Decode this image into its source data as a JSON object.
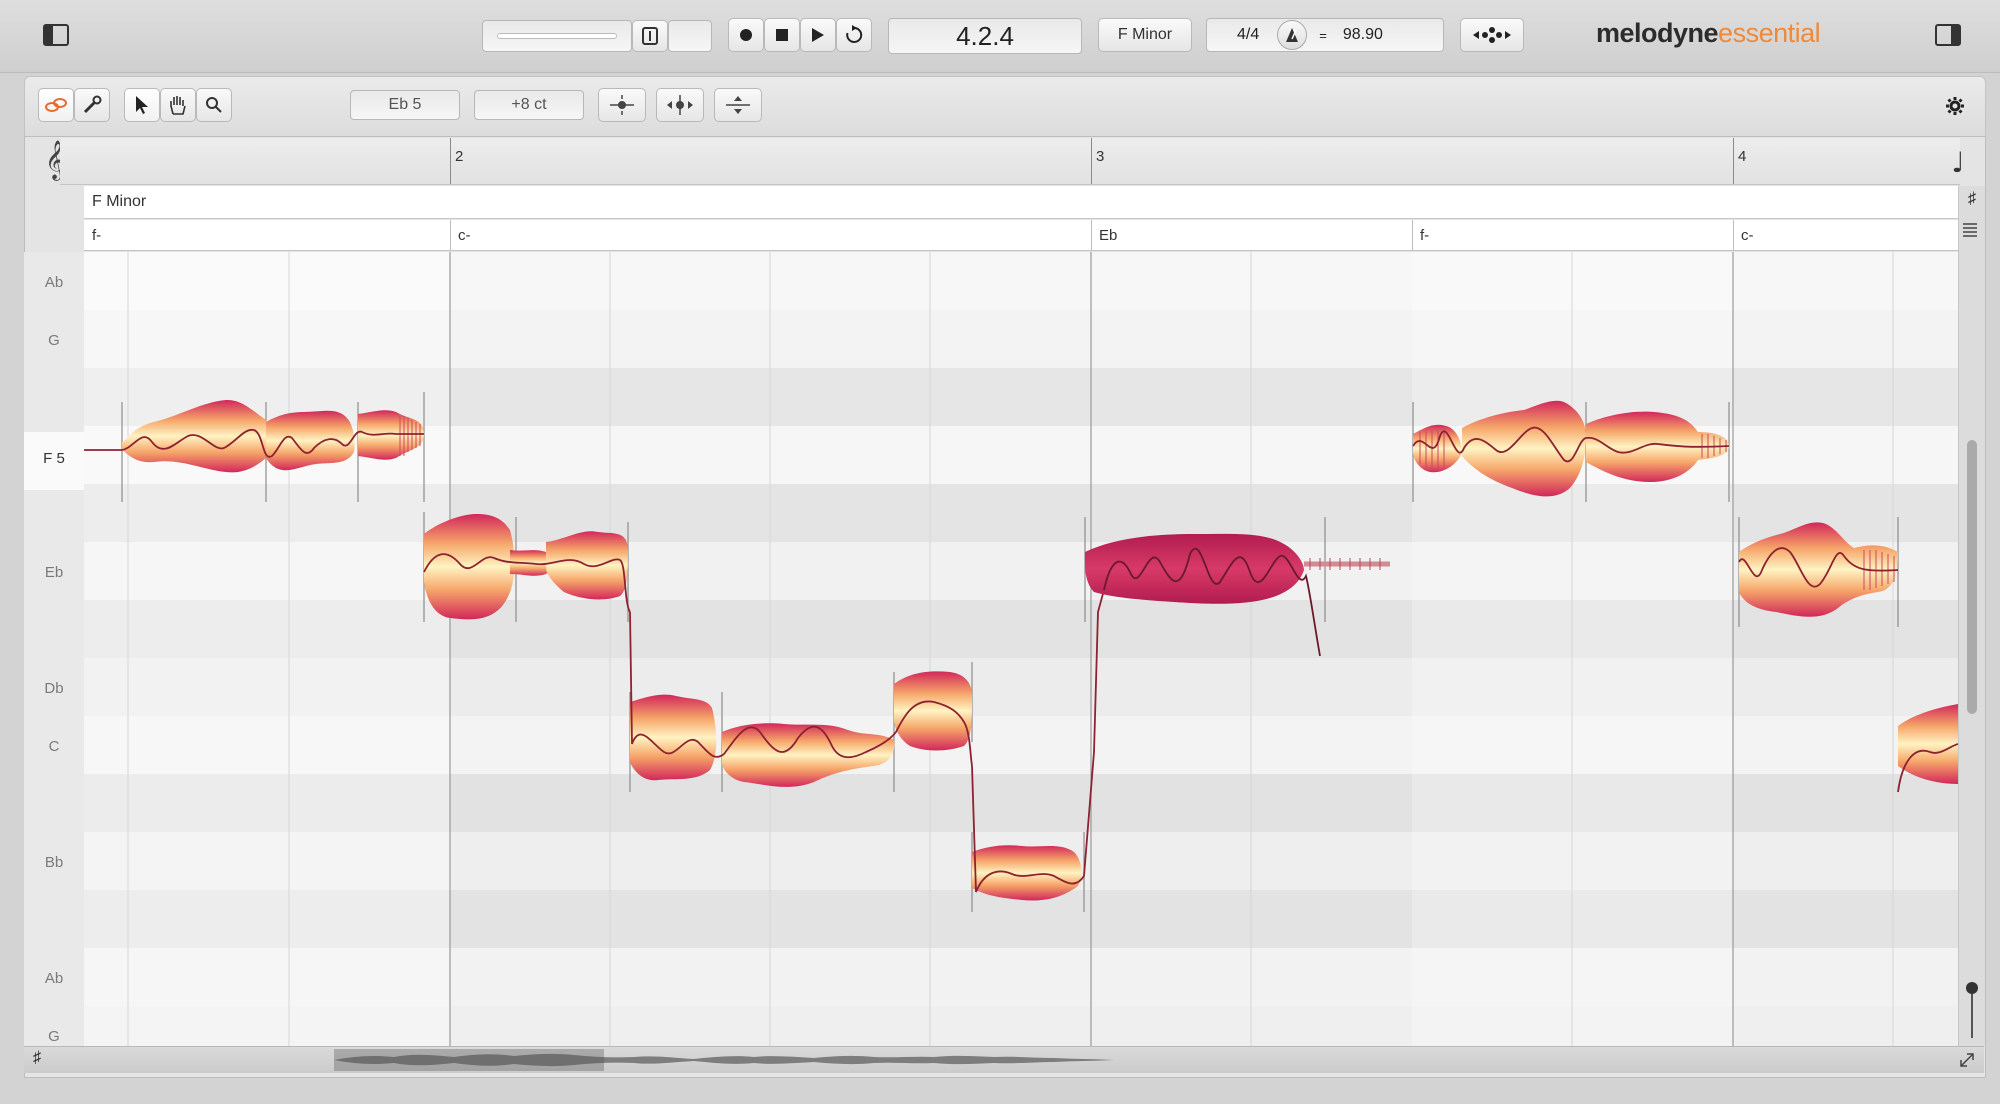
{
  "transport": {
    "position": "4.2.4",
    "key": "F Minor",
    "time_signature": "4/4",
    "tempo_eq": "=",
    "tempo": "98.90"
  },
  "brand": {
    "name": "melodyne",
    "edition": "essential"
  },
  "toolbar": {
    "pitch_readout": "Eb 5",
    "cents_readout": "+8 ct"
  },
  "ruler": {
    "bars": [
      "2",
      "3",
      "4"
    ]
  },
  "key_track": {
    "label": "F Minor"
  },
  "chords": [
    "f-",
    "c-",
    "Eb",
    "f-",
    "c-"
  ],
  "pitch_labels": [
    "Ab",
    "G",
    "F 5",
    "Eb",
    "Db",
    "C",
    "Bb",
    "Ab",
    "G"
  ],
  "icons": {
    "sidebar_left": "sidebar-toggle-left-icon",
    "sidebar_right": "sidebar-toggle-right-icon",
    "record": "record-icon",
    "stop": "stop-icon",
    "play": "play-icon",
    "loop": "loop-icon",
    "metronome": "metronome-icon",
    "settings": "gear-icon",
    "clef": "treble-clef-icon",
    "note": "eighth-note-icon",
    "scale": "scale-snap-icon"
  },
  "colors": {
    "blob_light": "#fff3c2",
    "blob_mid": "#f6a66a",
    "blob_dark": "#d2275a",
    "pitch_line": "#8e2230"
  }
}
